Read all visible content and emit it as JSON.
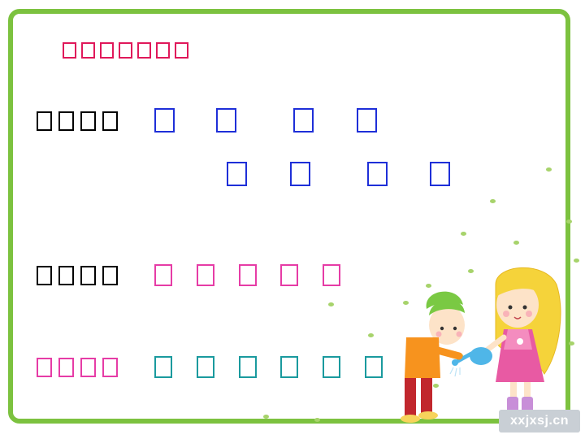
{
  "slide": {
    "frame_color": "#7cc23f",
    "title": {
      "glyphs": [
        "□",
        "□",
        "□",
        "□",
        "□",
        "□",
        "□"
      ],
      "color": "#e0185a"
    },
    "rows": [
      {
        "label": [
          "□",
          "□",
          "□",
          "□"
        ],
        "label_color": "#000000",
        "items": [
          "□",
          "□",
          "□",
          "□",
          "□",
          "□",
          "□",
          "□"
        ],
        "item_color": "#1e2fd8"
      },
      {
        "label": [
          "□",
          "□",
          "□",
          "□"
        ],
        "label_color": "#000000",
        "items": [
          "□",
          "□",
          "□",
          "□",
          "□"
        ],
        "item_color": "#e63ca6"
      },
      {
        "label": [
          "□",
          "□",
          "□",
          "□"
        ],
        "label_color": "#e63ca6",
        "items": [
          "□",
          "□",
          "□",
          "□",
          "□",
          "□"
        ],
        "item_color": "#1a9a9e"
      }
    ],
    "illustration": "two-children-watering-plant-illustration",
    "watermark": "xxjxsj.cn"
  }
}
